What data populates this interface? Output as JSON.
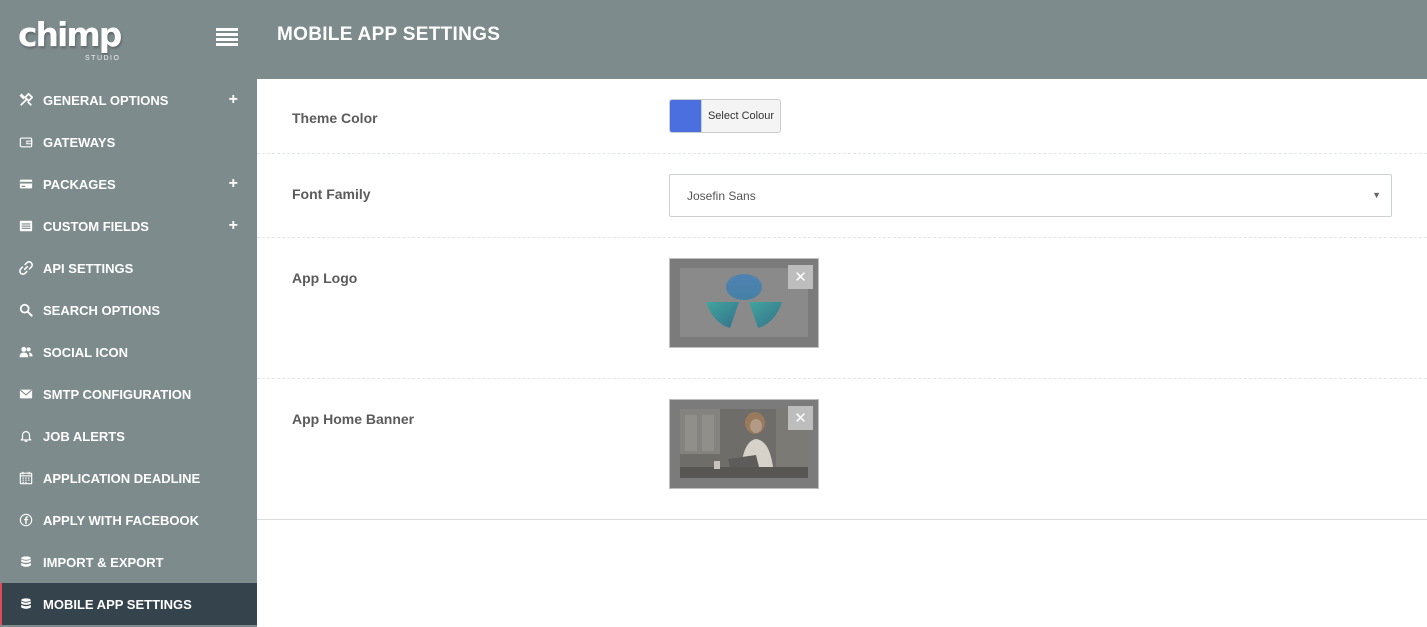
{
  "brand": {
    "logo_text": "chimp",
    "logo_sub": "STUDIO"
  },
  "header": {
    "title": "MOBILE APP SETTINGS"
  },
  "sidebar": {
    "items": [
      {
        "label": "GENERAL OPTIONS",
        "icon": "tools-icon",
        "expandable": true
      },
      {
        "label": "GATEWAYS",
        "icon": "wallet-icon",
        "expandable": false
      },
      {
        "label": "PACKAGES",
        "icon": "credit-card-icon",
        "expandable": true
      },
      {
        "label": "CUSTOM FIELDS",
        "icon": "list-box-icon",
        "expandable": true
      },
      {
        "label": "API SETTINGS",
        "icon": "link-icon",
        "expandable": false
      },
      {
        "label": "SEARCH OPTIONS",
        "icon": "search-icon",
        "expandable": false
      },
      {
        "label": "SOCIAL ICON",
        "icon": "users-icon",
        "expandable": false
      },
      {
        "label": "SMTP CONFIGURATION",
        "icon": "envelope-icon",
        "expandable": false
      },
      {
        "label": "JOB ALERTS",
        "icon": "bell-icon",
        "expandable": false
      },
      {
        "label": "APPLICATION DEADLINE",
        "icon": "calendar-icon",
        "expandable": false
      },
      {
        "label": "APPLY WITH FACEBOOK",
        "icon": "facebook-circle-icon",
        "expandable": false
      },
      {
        "label": "IMPORT & EXPORT",
        "icon": "database-icon",
        "expandable": false
      },
      {
        "label": "MOBILE APP SETTINGS",
        "icon": "database-icon",
        "expandable": false,
        "active": true
      }
    ],
    "expand_symbol": "+"
  },
  "settings": {
    "theme_color": {
      "label": "Theme Color",
      "button": "Select Colour",
      "value": "#4b6fde"
    },
    "font_family": {
      "label": "Font Family",
      "value": "Josefin Sans"
    },
    "app_logo": {
      "label": "App Logo",
      "remove_symbol": "✕"
    },
    "app_home_banner": {
      "label": "App Home Banner",
      "remove_symbol": "✕"
    }
  },
  "colors": {
    "sidebar_bg": "#7e8b8c",
    "active_bg": "#35434c",
    "accent": "#e04b5a"
  }
}
